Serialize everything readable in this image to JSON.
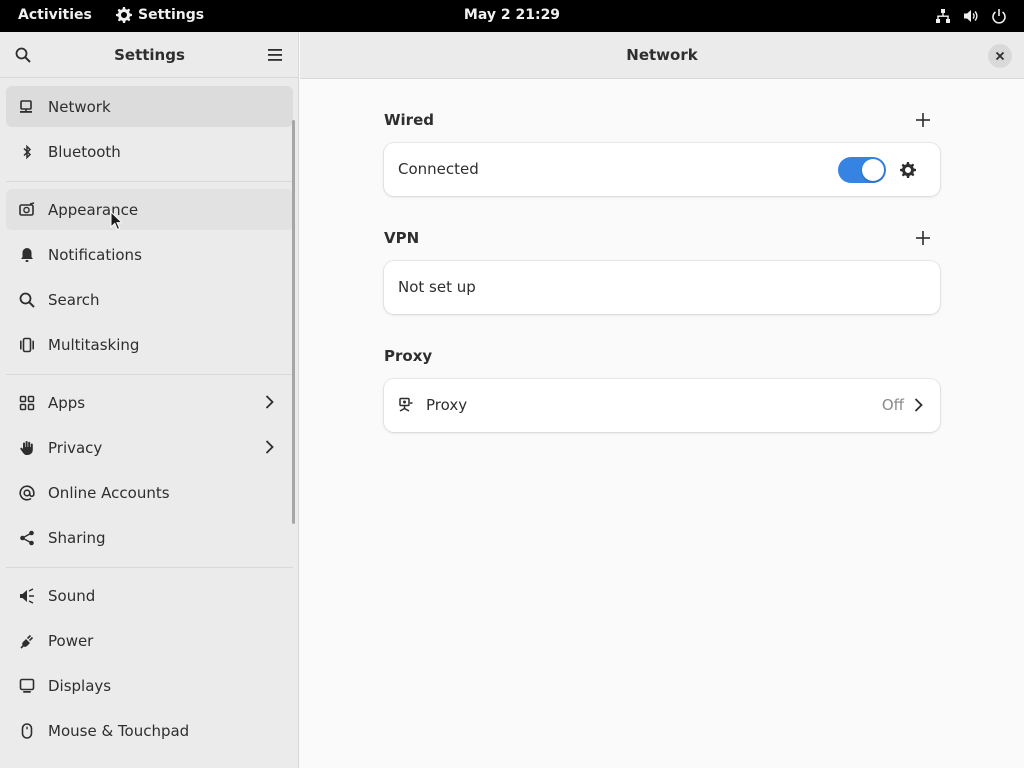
{
  "topbar": {
    "activities": "Activities",
    "app_name": "Settings",
    "clock": "May 2  21:29",
    "tray": [
      "network-icon",
      "volume-icon",
      "power-icon"
    ]
  },
  "sidebar": {
    "title": "Settings",
    "items": [
      {
        "label": "Network",
        "icon": "network-wired-icon",
        "selected": true
      },
      {
        "label": "Bluetooth",
        "icon": "bluetooth-icon"
      },
      {
        "label": "Appearance",
        "icon": "appearance-icon",
        "hover": true
      },
      {
        "label": "Notifications",
        "icon": "bell-icon"
      },
      {
        "label": "Search",
        "icon": "search-icon"
      },
      {
        "label": "Multitasking",
        "icon": "multitasking-icon"
      },
      {
        "label": "Apps",
        "icon": "apps-grid-icon",
        "submenu": true
      },
      {
        "label": "Privacy",
        "icon": "hand-icon",
        "submenu": true
      },
      {
        "label": "Online Accounts",
        "icon": "at-sign-icon"
      },
      {
        "label": "Sharing",
        "icon": "share-icon"
      },
      {
        "label": "Sound",
        "icon": "speaker-icon"
      },
      {
        "label": "Power",
        "icon": "power-plug-icon"
      },
      {
        "label": "Displays",
        "icon": "display-icon"
      },
      {
        "label": "Mouse & Touchpad",
        "icon": "mouse-icon"
      }
    ]
  },
  "main": {
    "title": "Network",
    "sections": {
      "wired": {
        "title": "Wired",
        "status": "Connected",
        "toggle_on": true
      },
      "vpn": {
        "title": "VPN",
        "status": "Not set up"
      },
      "proxy": {
        "title": "Proxy",
        "label": "Proxy",
        "value": "Off"
      }
    }
  },
  "colors": {
    "accent": "#3584e4",
    "topbar": "#000000",
    "sidebar_bg": "#ebebeb",
    "content_bg": "#fafafa"
  }
}
